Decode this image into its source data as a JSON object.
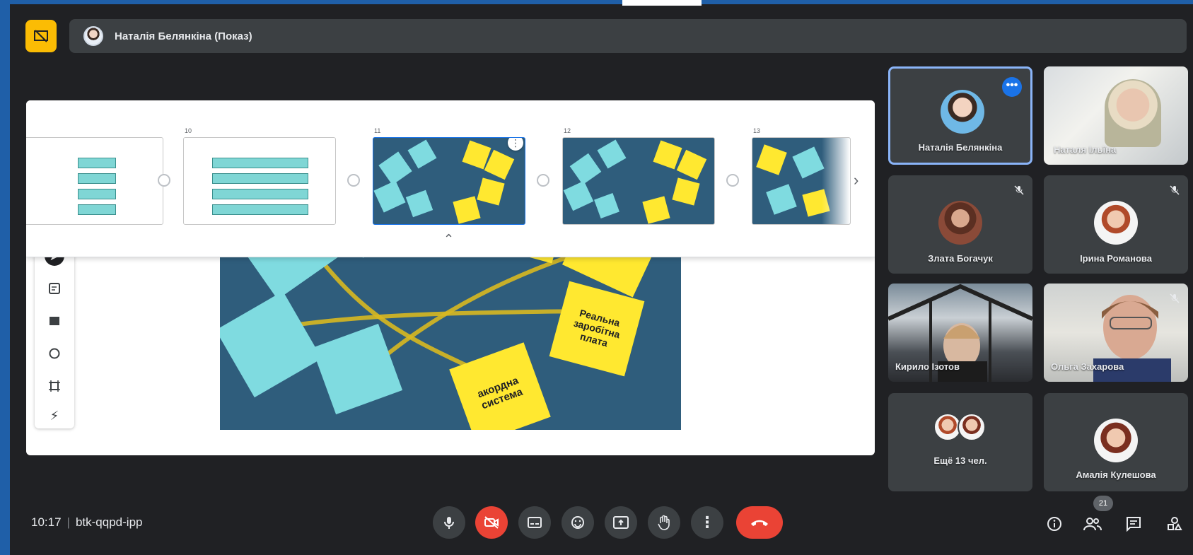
{
  "presenter": {
    "name": "Наталія Белянкіна (Показ)"
  },
  "filmstrip": {
    "slide_numbers": [
      "10",
      "11",
      "12",
      "13"
    ]
  },
  "participants": [
    {
      "name": "Наталія Белянкіна"
    },
    {
      "name": "Наталя Ільїна"
    },
    {
      "name": "Злата Богачук"
    },
    {
      "name": "Ірина Романова"
    },
    {
      "name": "Кирило Ізотов"
    },
    {
      "name": "Ольга Захарова"
    },
    {
      "name": "Ещё 13 чел."
    },
    {
      "name": "Амалія Кулешова"
    }
  ],
  "meeting": {
    "time": "10:17",
    "code": "btk-qqpd-ipp",
    "participant_count": "21"
  },
  "board": {
    "notes": [
      "Реальна заробітна плата",
      "акордна система"
    ]
  },
  "colors": {
    "accent": "#1a73e8",
    "danger": "#ea4335",
    "present": "#fbbc04",
    "board_bg": "#2f5d7c",
    "sticky_yellow": "#ffe830",
    "sticky_cyan": "#7fdbe0"
  }
}
